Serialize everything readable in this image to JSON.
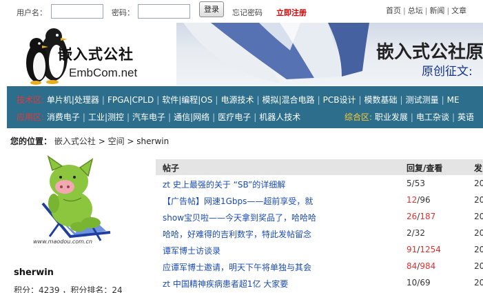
{
  "login": {
    "username_label": "用户名：",
    "password_label": "密码：",
    "login_button": "登录",
    "forgot_link": "忘记密码",
    "register_link": "立即注册"
  },
  "topnav": {
    "items": [
      "首页",
      "总坛",
      "新闻",
      "文章"
    ]
  },
  "banner": {
    "logo_title": "嵌入式公社",
    "logo_sub": "EmbCom.net",
    "ad_title": "嵌入式公社原",
    "ad_sub": "原创征文:"
  },
  "categories": {
    "row1_head": "技术区:",
    "row1": [
      "单片机|处理器",
      "FPGA|CPLD",
      "软件|编程|OS",
      "电源技术",
      "模拟|混合电路",
      "PCB设计",
      "模数基础",
      "测试测量",
      "ME"
    ],
    "row2_head": "应用区:",
    "row2": [
      "消费电子",
      "工业|测控",
      "汽车电子",
      "通信|网络",
      "医疗电子",
      "机器人技术"
    ],
    "row3_head": "综合区:",
    "row3": [
      "职业发展",
      "电工杂谈",
      "英语"
    ]
  },
  "breadcrumb": {
    "label": "您的位置：",
    "home": "嵌入式公社",
    "space": "空间",
    "user": "sherwin"
  },
  "profile": {
    "username": "sherwin",
    "score_text": "积分：4239 ，积分排名：24",
    "avatar_caption": "www.maodou.com.cn"
  },
  "posts": {
    "headers": [
      "帖子",
      "回复/查看",
      "发"
    ],
    "rows": [
      {
        "title": "zt 史上最强的关于 “SB”的详细解",
        "replies": "5",
        "views": "53",
        "hot": false,
        "date": "20"
      },
      {
        "title": "【广告帖】网速1Gbps——超前享受，就",
        "replies": "12",
        "views": "96",
        "hot": "replies",
        "date": "20"
      },
      {
        "title": "show宝贝啦——今天拿到奖品了，哈哈哈",
        "replies": "26",
        "views": "187",
        "hot": "both",
        "date": "20"
      },
      {
        "title": "哈哈，好难得的吉利数字，特此发帖留念",
        "replies": "2",
        "views": "32",
        "hot": false,
        "date": "20"
      },
      {
        "title": "谭军博士访谈录",
        "replies": "91",
        "views": "1254",
        "hot": "both",
        "date": "20"
      },
      {
        "title": "应谭军博士邀请，明天下午将单独与其会",
        "replies": "84",
        "views": "984",
        "hot": "both",
        "date": "20"
      },
      {
        "title": "zt 中国精神疾病患者超1亿 大家要",
        "replies": "10",
        "views": "69",
        "hot": false,
        "date": "20"
      }
    ]
  },
  "colors": {
    "catbar": "#2c6e8c",
    "link_blue": "#1a4bb5",
    "hot_red": "#e03030",
    "register_red": "#e00000"
  }
}
